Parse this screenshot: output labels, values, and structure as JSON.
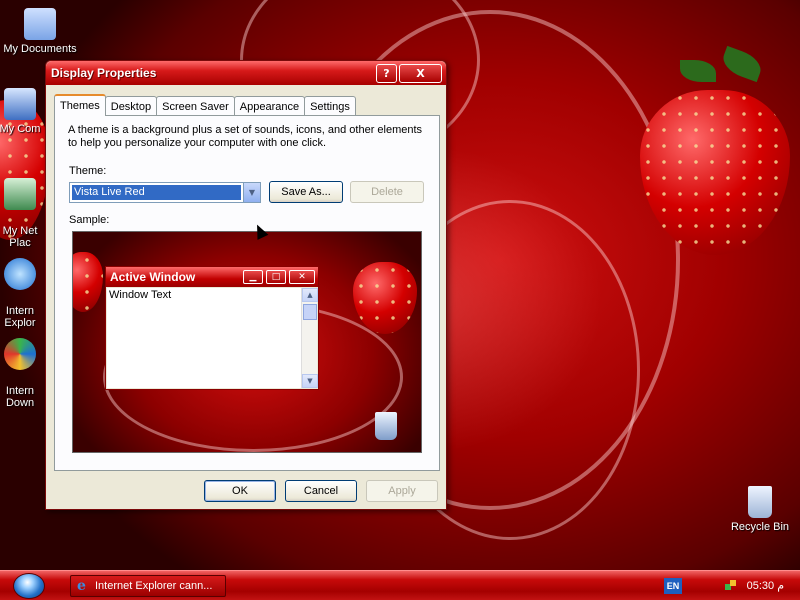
{
  "desktop": {
    "icons": [
      {
        "label": "My Documents",
        "icon": "my-documents-icon"
      },
      {
        "label": "My Com",
        "icon": "my-computer-icon"
      },
      {
        "label": "My Net\nPlac",
        "icon": "network-places-icon"
      },
      {
        "label": "Intern\nExplor",
        "icon": "internet-explorer-icon"
      },
      {
        "label": "Intern\nDown",
        "icon": "internet-download-icon"
      },
      {
        "label": "Recycle Bin",
        "icon": "recycle-bin-icon"
      }
    ]
  },
  "window": {
    "title": "Display Properties",
    "controls": {
      "help": "?",
      "close": "X"
    },
    "tabs": [
      "Themes",
      "Desktop",
      "Screen Saver",
      "Appearance",
      "Settings"
    ],
    "active_tab": "Themes",
    "description": "A theme is a background plus a set of sounds, icons, and other elements to help you personalize your computer with one click.",
    "theme_label": "Theme:",
    "theme_value": "Vista Live Red",
    "save_as": "Save As...",
    "delete": "Delete",
    "sample_label": "Sample:",
    "sample": {
      "window_title": "Active Window",
      "window_text": "Window Text"
    },
    "ok": "OK",
    "cancel": "Cancel",
    "apply": "Apply"
  },
  "taskbar": {
    "task_label": "Internet Explorer cann...",
    "language": "EN",
    "clock": "05:30 م"
  },
  "colors": {
    "accent": "#c70a0a",
    "selection": "#316ac5"
  }
}
